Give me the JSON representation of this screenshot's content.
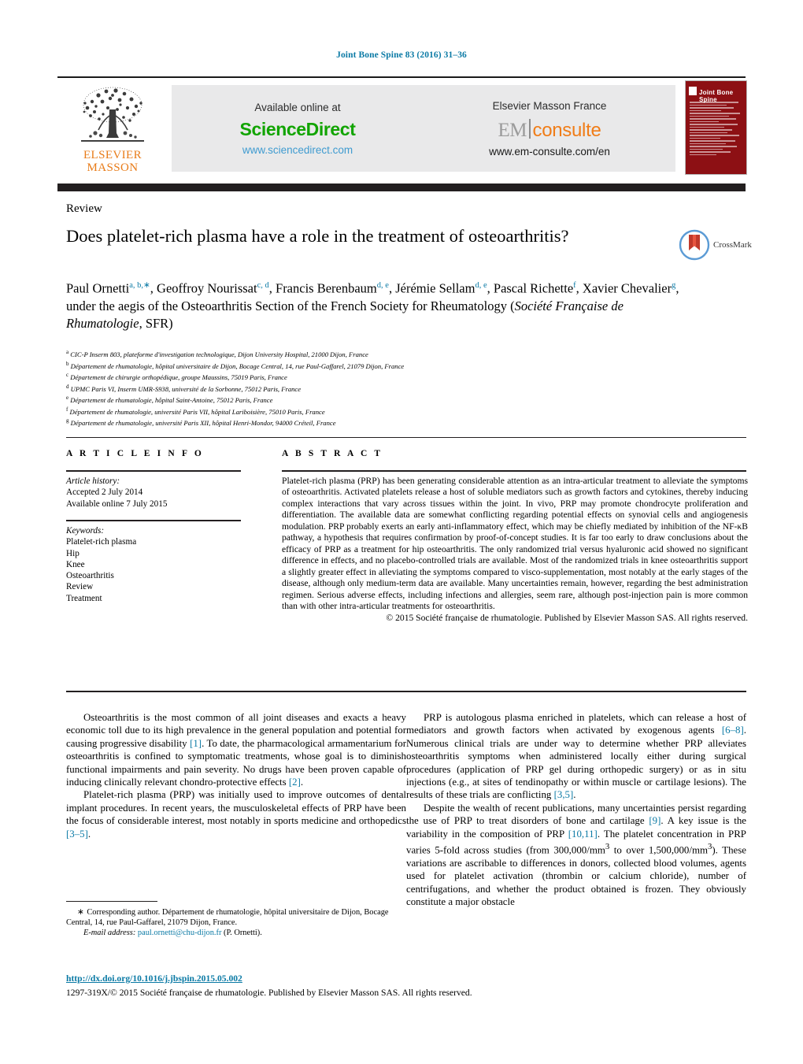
{
  "running_head": "Joint Bone Spine 83 (2016) 31–36",
  "masthead": {
    "publisher_logo_lines": [
      "ELSEVIER",
      "MASSON"
    ],
    "publisher_logo_icon": "tree-logo-icon",
    "sciencedirect": {
      "available_text": "Available online at",
      "logo_text": "ScienceDirect",
      "url": "www.sciencedirect.com",
      "logo_color": "#11a400",
      "url_color": "#3f9bd0"
    },
    "emconsulte": {
      "heading": "Elsevier Masson France",
      "logo_part1": "EM",
      "logo_part2": "consulte",
      "url": "www.em-consulte.com/en",
      "part1_color": "#9b9b9b",
      "part2_color": "#f07d18"
    },
    "cover": {
      "title": "Joint Bone Spine",
      "background_color": "#8d1014"
    }
  },
  "article": {
    "section_label": "Review",
    "title": "Does platelet-rich plasma have a role in the treatment of osteoarthritis?",
    "crossmark_label": "CrossMark",
    "authors_html": "Paul Ornetti<sup>a, b,∗</sup>, Geoffroy Nourissat<sup>c, d</sup>, Francis Berenbaum<sup>d, e</sup>, Jérémie Sellam<sup>d, e</sup>, Pascal Richette<sup>f</sup>, Xavier Chevalier<sup>g</sup>, under the aegis of the Osteoarthritis Section of the French Society for Rheumatology (<span class=\"ital\">Société Française de Rhumatologie</span>, SFR)",
    "affiliations": [
      {
        "marker": "a",
        "text": "CIC-P Inserm 803, plateforme d'investigation technologique, Dijon University Hospital, 21000 Dijon, France"
      },
      {
        "marker": "b",
        "text": "Département de rhumatologie, hôpital universitaire de Dijon, Bocage Central, 14, rue Paul-Gaffarel, 21079 Dijon, France"
      },
      {
        "marker": "c",
        "text": "Département de chirurgie orthopédique, groupe Maussins, 75019 Paris, France"
      },
      {
        "marker": "d",
        "text": "UPMC Paris VI, Inserm UMR-S938, université de la Sorbonne, 75012 Paris, France"
      },
      {
        "marker": "e",
        "text": "Département de rhumatologie, hôpital Saint-Antoine, 75012 Paris, France"
      },
      {
        "marker": "f",
        "text": "Département de rhumatologie, université Paris VII, hôpital Lariboisière, 75010 Paris, France"
      },
      {
        "marker": "g",
        "text": "Département de rhumatologie, université Paris XII, hôpital Henri-Mondor, 94000 Créteil, France"
      }
    ]
  },
  "article_info": {
    "heading": "A R T I C L E   I N F O",
    "history_label": "Article history:",
    "history": [
      "Accepted 2 July 2014",
      "Available online 7 July 2015"
    ],
    "keywords_label": "Keywords:",
    "keywords": [
      "Platelet-rich plasma",
      "Hip",
      "Knee",
      "Osteoarthritis",
      "Review",
      "Treatment"
    ]
  },
  "abstract": {
    "heading": "A B S T R A C T",
    "body": "Platelet-rich plasma (PRP) has been generating considerable attention as an intra-articular treatment to alleviate the symptoms of osteoarthritis. Activated platelets release a host of soluble mediators such as growth factors and cytokines, thereby inducing complex interactions that vary across tissues within the joint. In vivo, PRP may promote chondrocyte proliferation and differentiation. The available data are somewhat conflicting regarding potential effects on synovial cells and angiogenesis modulation. PRP probably exerts an early anti-inflammatory effect, which may be chiefly mediated by inhibition of the NF-κB pathway, a hypothesis that requires confirmation by proof-of-concept studies. It is far too early to draw conclusions about the efficacy of PRP as a treatment for hip osteoarthritis. The only randomized trial versus hyaluronic acid showed no significant difference in effects, and no placebo-controlled trials are available. Most of the randomized trials in knee osteoarthritis support a slightly greater effect in alleviating the symptoms compared to visco-supplementation, most notably at the early stages of the disease, although only medium-term data are available. Many uncertainties remain, however, regarding the best administration regimen. Serious adverse effects, including infections and allergies, seem rare, although post-injection pain is more common than with other intra-articular treatments for osteoarthritis.",
    "copyright": "© 2015 Société française de rhumatologie. Published by Elsevier Masson SAS. All rights reserved."
  },
  "body": {
    "left_column": [
      "Osteoarthritis is the most common of all joint diseases and exacts a heavy economic toll due to its high prevalence in the general population and potential for causing progressive disability [1]. To date, the pharmacological armamentarium for osteoarthritis is confined to symptomatic treatments, whose goal is to diminish functional impairments and pain severity. No drugs have been proven capable of inducing clinically relevant chondro-protective effects [2].",
      "Platelet-rich plasma (PRP) was initially used to improve outcomes of dental implant procedures. In recent years, the musculoskeletal effects of PRP have been the focus of considerable interest, most notably in sports medicine and orthopedics [3–5]."
    ],
    "right_column": [
      "PRP is autologous plasma enriched in platelets, which can release a host of mediators and growth factors when activated by exogenous agents [6–8]. Numerous clinical trials are under way to determine whether PRP alleviates osteoarthritis symptoms when administered locally either during surgical procedures (application of PRP gel during orthopedic surgery) or as in situ injections (e.g., at sites of tendinopathy or within muscle or cartilage lesions). The results of these trials are conflicting [3,5].",
      "Despite the wealth of recent publications, many uncertainties persist regarding the use of PRP to treat disorders of bone and cartilage [9]. A key issue is the variability in the composition of PRP [10,11]. The platelet concentration in PRP varies 5-fold across studies (from 300,000/mm³ to over 1,500,000/mm³). These variations are ascribable to differences in donors, collected blood volumes, agents used for platelet activation (thrombin or calcium chloride), number of centrifugations, and whether the product obtained is frozen. They obviously constitute a major obstacle"
    ]
  },
  "footer": {
    "corresponding_marker": "∗",
    "corresponding_text": "Corresponding author. Département de rhumatologie, hôpital universitaire de Dijon, Bocage Central, 14, rue Paul-Gaffarel, 21079 Dijon, France.",
    "email_label": "E-mail address:",
    "email": "paul.ornetti@chu-dijon.fr",
    "email_attribution": "(P. Ornetti).",
    "doi": "http://dx.doi.org/10.1016/j.jbspin.2015.05.002",
    "issn_line": "1297-319X/© 2015 Société française de rhumatologie. Published by Elsevier Masson SAS. All rights reserved.",
    "link_color": "#0b7aa5"
  }
}
